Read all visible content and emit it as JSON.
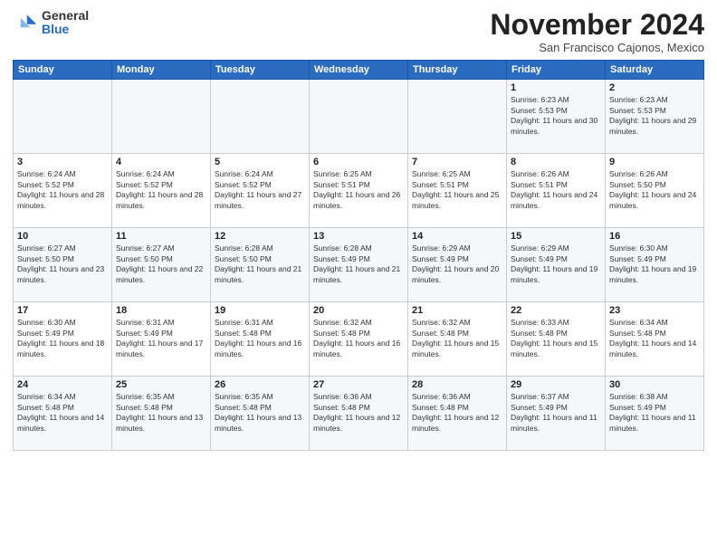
{
  "header": {
    "logo_general": "General",
    "logo_blue": "Blue",
    "month": "November 2024",
    "location": "San Francisco Cajonos, Mexico"
  },
  "weekdays": [
    "Sunday",
    "Monday",
    "Tuesday",
    "Wednesday",
    "Thursday",
    "Friday",
    "Saturday"
  ],
  "weeks": [
    [
      {
        "day": "",
        "info": ""
      },
      {
        "day": "",
        "info": ""
      },
      {
        "day": "",
        "info": ""
      },
      {
        "day": "",
        "info": ""
      },
      {
        "day": "",
        "info": ""
      },
      {
        "day": "1",
        "info": "Sunrise: 6:23 AM\nSunset: 5:53 PM\nDaylight: 11 hours and 30 minutes."
      },
      {
        "day": "2",
        "info": "Sunrise: 6:23 AM\nSunset: 5:53 PM\nDaylight: 11 hours and 29 minutes."
      }
    ],
    [
      {
        "day": "3",
        "info": "Sunrise: 6:24 AM\nSunset: 5:52 PM\nDaylight: 11 hours and 28 minutes."
      },
      {
        "day": "4",
        "info": "Sunrise: 6:24 AM\nSunset: 5:52 PM\nDaylight: 11 hours and 28 minutes."
      },
      {
        "day": "5",
        "info": "Sunrise: 6:24 AM\nSunset: 5:52 PM\nDaylight: 11 hours and 27 minutes."
      },
      {
        "day": "6",
        "info": "Sunrise: 6:25 AM\nSunset: 5:51 PM\nDaylight: 11 hours and 26 minutes."
      },
      {
        "day": "7",
        "info": "Sunrise: 6:25 AM\nSunset: 5:51 PM\nDaylight: 11 hours and 25 minutes."
      },
      {
        "day": "8",
        "info": "Sunrise: 6:26 AM\nSunset: 5:51 PM\nDaylight: 11 hours and 24 minutes."
      },
      {
        "day": "9",
        "info": "Sunrise: 6:26 AM\nSunset: 5:50 PM\nDaylight: 11 hours and 24 minutes."
      }
    ],
    [
      {
        "day": "10",
        "info": "Sunrise: 6:27 AM\nSunset: 5:50 PM\nDaylight: 11 hours and 23 minutes."
      },
      {
        "day": "11",
        "info": "Sunrise: 6:27 AM\nSunset: 5:50 PM\nDaylight: 11 hours and 22 minutes."
      },
      {
        "day": "12",
        "info": "Sunrise: 6:28 AM\nSunset: 5:50 PM\nDaylight: 11 hours and 21 minutes."
      },
      {
        "day": "13",
        "info": "Sunrise: 6:28 AM\nSunset: 5:49 PM\nDaylight: 11 hours and 21 minutes."
      },
      {
        "day": "14",
        "info": "Sunrise: 6:29 AM\nSunset: 5:49 PM\nDaylight: 11 hours and 20 minutes."
      },
      {
        "day": "15",
        "info": "Sunrise: 6:29 AM\nSunset: 5:49 PM\nDaylight: 11 hours and 19 minutes."
      },
      {
        "day": "16",
        "info": "Sunrise: 6:30 AM\nSunset: 5:49 PM\nDaylight: 11 hours and 19 minutes."
      }
    ],
    [
      {
        "day": "17",
        "info": "Sunrise: 6:30 AM\nSunset: 5:49 PM\nDaylight: 11 hours and 18 minutes."
      },
      {
        "day": "18",
        "info": "Sunrise: 6:31 AM\nSunset: 5:49 PM\nDaylight: 11 hours and 17 minutes."
      },
      {
        "day": "19",
        "info": "Sunrise: 6:31 AM\nSunset: 5:48 PM\nDaylight: 11 hours and 16 minutes."
      },
      {
        "day": "20",
        "info": "Sunrise: 6:32 AM\nSunset: 5:48 PM\nDaylight: 11 hours and 16 minutes."
      },
      {
        "day": "21",
        "info": "Sunrise: 6:32 AM\nSunset: 5:48 PM\nDaylight: 11 hours and 15 minutes."
      },
      {
        "day": "22",
        "info": "Sunrise: 6:33 AM\nSunset: 5:48 PM\nDaylight: 11 hours and 15 minutes."
      },
      {
        "day": "23",
        "info": "Sunrise: 6:34 AM\nSunset: 5:48 PM\nDaylight: 11 hours and 14 minutes."
      }
    ],
    [
      {
        "day": "24",
        "info": "Sunrise: 6:34 AM\nSunset: 5:48 PM\nDaylight: 11 hours and 14 minutes."
      },
      {
        "day": "25",
        "info": "Sunrise: 6:35 AM\nSunset: 5:48 PM\nDaylight: 11 hours and 13 minutes."
      },
      {
        "day": "26",
        "info": "Sunrise: 6:35 AM\nSunset: 5:48 PM\nDaylight: 11 hours and 13 minutes."
      },
      {
        "day": "27",
        "info": "Sunrise: 6:36 AM\nSunset: 5:48 PM\nDaylight: 11 hours and 12 minutes."
      },
      {
        "day": "28",
        "info": "Sunrise: 6:36 AM\nSunset: 5:48 PM\nDaylight: 11 hours and 12 minutes."
      },
      {
        "day": "29",
        "info": "Sunrise: 6:37 AM\nSunset: 5:49 PM\nDaylight: 11 hours and 11 minutes."
      },
      {
        "day": "30",
        "info": "Sunrise: 6:38 AM\nSunset: 5:49 PM\nDaylight: 11 hours and 11 minutes."
      }
    ]
  ]
}
